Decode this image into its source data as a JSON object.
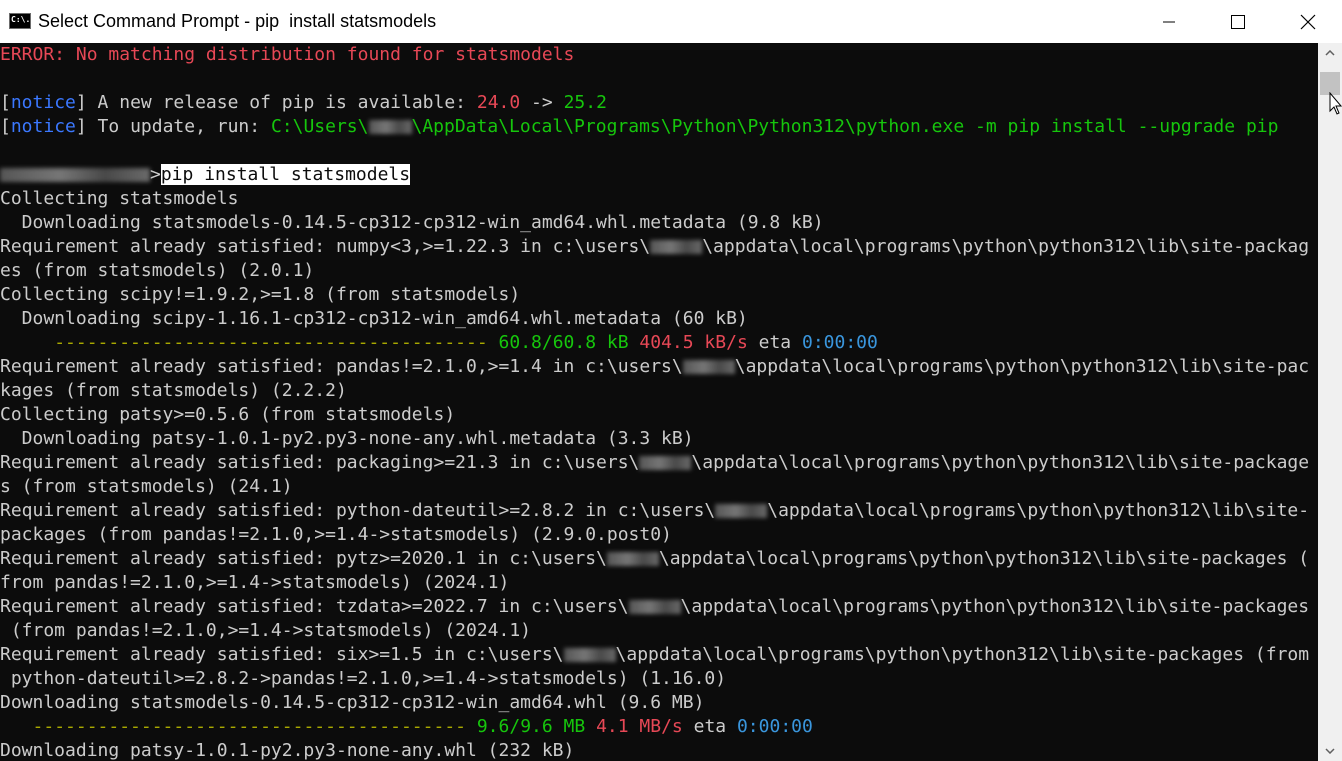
{
  "window": {
    "title": "Select Command Prompt - pip  install statsmodels",
    "app_icon": "command-prompt-icon",
    "app_icon_text": "C:\\.",
    "controls": [
      "minimize-icon",
      "maximize-icon",
      "close-icon"
    ]
  },
  "colors": {
    "background": "#0c0c0c",
    "text": "#cccccc",
    "error_red": "#e74856",
    "notice_blue": "#3b78ff",
    "green": "#16c60c",
    "eta_blue": "#3a96dd"
  },
  "console": {
    "error_line": "ERROR: No matching distribution found for statsmodels",
    "notice1": {
      "bracket_open": "[",
      "tag": "notice",
      "bracket_close": "]",
      "text": " A new release of pip is available: ",
      "old_version": "24.0",
      "arrow": " -> ",
      "new_version": "25.2"
    },
    "notice2": {
      "bracket_open": "[",
      "tag": "notice",
      "bracket_close": "]",
      "text": " To update, run: ",
      "cmd_part1": "C:\\Users\\",
      "cmd_part2": "\\AppData\\Local\\Programs\\Python\\Python312\\python.exe -m pip install --upgrade pip"
    },
    "prompt": {
      "gt": ">",
      "command": "pip install statsmodels"
    },
    "lines": [
      "Collecting statsmodels",
      "  Downloading statsmodels-0.14.5-cp312-cp312-win_amd64.whl.metadata (9.8 kB)",
      "Requirement already satisfied: numpy<3,>=1.22.3 in c:\\users\\",
      "\\appdata\\local\\programs\\python\\python312\\lib\\site-packag",
      "es (from statsmodels) (2.0.1)",
      "Collecting scipy!=1.9.2,>=1.8 (from statsmodels)",
      "  Downloading scipy-1.16.1-cp312-cp312-win_amd64.whl.metadata (60 kB)",
      "Requirement already satisfied: pandas!=2.1.0,>=1.4 in c:\\users\\",
      "\\appdata\\local\\programs\\python\\python312\\lib\\site-pac",
      "kages (from statsmodels) (2.2.2)",
      "Collecting patsy>=0.5.6 (from statsmodels)",
      "  Downloading patsy-1.0.1-py2.py3-none-any.whl.metadata (3.3 kB)",
      "Requirement already satisfied: packaging>=21.3 in c:\\users\\",
      "\\appdata\\local\\programs\\python\\python312\\lib\\site-package",
      "s (from statsmodels) (24.1)",
      "Requirement already satisfied: python-dateutil>=2.8.2 in c:\\users\\",
      "\\appdata\\local\\programs\\python\\python312\\lib\\site-",
      "packages (from pandas!=2.1.0,>=1.4->statsmodels) (2.9.0.post0)",
      "Requirement already satisfied: pytz>=2020.1 in c:\\users\\",
      "\\appdata\\local\\programs\\python\\python312\\lib\\site-packages (",
      "from pandas!=2.1.0,>=1.4->statsmodels) (2024.1)",
      "Requirement already satisfied: tzdata>=2022.7 in c:\\users\\",
      "\\appdata\\local\\programs\\python\\python312\\lib\\site-packages",
      " (from pandas!=2.1.0,>=1.4->statsmodels) (2024.1)",
      "Requirement already satisfied: six>=1.5 in c:\\users\\",
      "\\appdata\\local\\programs\\python\\python312\\lib\\site-packages (from",
      " python-dateutil>=2.8.2->pandas!=2.1.0,>=1.4->statsmodels) (1.16.0)",
      "Downloading statsmodels-0.14.5-cp312-cp312-win_amd64.whl (9.6 MB)",
      "Downloading patsy-1.0.1-py2.py3-none-any.whl (232 kB)"
    ],
    "progress1": {
      "bar": "----------------------------------------",
      "amount": "60.8/60.8 kB",
      "speed": "404.5 kB/s",
      "eta_label": "eta",
      "eta": "0:00:00",
      "fraction": 1.0
    },
    "progress2": {
      "bar": "----------------------------------------",
      "amount": "9.6/9.6 MB",
      "speed": "4.1 MB/s",
      "eta_label": "eta",
      "eta": "0:00:00",
      "fraction": 1.0
    }
  },
  "scrollbar": {
    "up_icon": "scroll-up-arrow-icon",
    "down_icon": "scroll-down-arrow-icon"
  }
}
